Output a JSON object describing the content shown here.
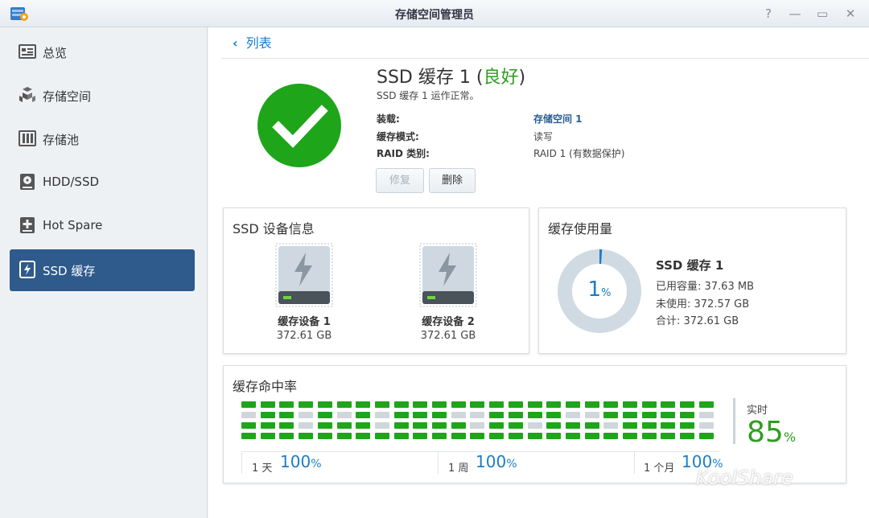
{
  "window": {
    "title": "存储空间管理员",
    "help_glyph": "?",
    "minimize_glyph": "—",
    "maximize_glyph": "▭",
    "close_glyph": "✕"
  },
  "sidebar": {
    "items": [
      {
        "label": "总览",
        "icon": "overview-icon"
      },
      {
        "label": "存储空间",
        "icon": "volume-icon"
      },
      {
        "label": "存储池",
        "icon": "storage-pool-icon"
      },
      {
        "label": "HDD/SSD",
        "icon": "disk-icon"
      },
      {
        "label": "Hot Spare",
        "icon": "hot-spare-icon"
      },
      {
        "label": "SSD 缓存",
        "icon": "ssd-cache-icon",
        "active": true
      }
    ]
  },
  "header": {
    "back_label": "列表",
    "title_prefix": "SSD 缓存 1 (",
    "title_status": "良好",
    "title_suffix": ")",
    "subtitle": "SSD 缓存 1 运作正常。",
    "fields": [
      {
        "key": "装载:",
        "value": "存储空间 1",
        "link": true
      },
      {
        "key": "缓存模式:",
        "value": "读写"
      },
      {
        "key": "RAID 类别:",
        "value": "RAID 1 (有数据保护)"
      }
    ],
    "repair_label": "修复",
    "delete_label": "删除"
  },
  "device_panel": {
    "title": "SSD 设备信息",
    "devices": [
      {
        "name": "缓存设备 1",
        "size": "372.61 GB"
      },
      {
        "name": "缓存设备 2",
        "size": "372.61 GB"
      }
    ]
  },
  "usage_panel": {
    "title": "缓存使用量",
    "percent": "1",
    "percent_unit": "%",
    "percent_value": 0.01,
    "name": "SSD 缓存 1",
    "used": "已用容量: 37.63 MB",
    "unused": "未使用: 372.57 GB",
    "total": "合计: 372.61 GB"
  },
  "hit_panel": {
    "title": "缓存命中率",
    "realtime_label": "实时",
    "realtime_value": "85",
    "unit": "%",
    "periods": [
      {
        "label": "1 天",
        "value": "100"
      },
      {
        "label": "1 周",
        "value": "100"
      },
      {
        "label": "1 个月",
        "value": "100"
      }
    ],
    "grid_rows": [
      "1111111111111111111111111",
      "0110101011100111100111110",
      "1110111011110110111011110",
      "1111111111111111111111111"
    ],
    "colors": {
      "hit": "#1ea51a",
      "miss": "#cfd6dc"
    }
  },
  "watermark": "KoolShare"
}
